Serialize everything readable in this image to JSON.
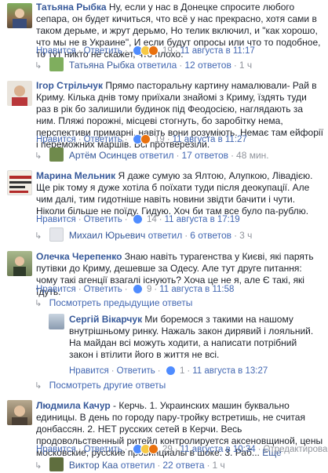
{
  "c1": {
    "author": "Татьяна Рыбка",
    "text": "Ну, если у нас в Донецке спросите любого сепара, он будет кичиться, что всё у нас прекрасно, хотя сами в таком дерьме, и жрут дерьмо, Но телик включил, и \"как хорошо, что мы не в Украине\", И если будут опросы или что то подобное, то тут никто не скажет, что плохо.",
    "like": "Нравится",
    "reply": "Ответить",
    "react_count": "19",
    "date": "11 августа в 11:17",
    "replies_by": "Татьяна Рыбка",
    "replied_word": "ответила",
    "replies_count": "12 ответов",
    "replies_time": "1 ч"
  },
  "c2": {
    "author": "Ігор Стрільчук",
    "text": "Прямо пасторальну картину намалювали- Рай в Криму. Кілька днів тому приїхали знайомі з Криму, їздять туди раз в рік бо залишили будинок під Феодосією, наглядають за ним. Пляжі порожні, місцеві стогнуть, бо заробітку нема, перспективи примарні, навіть вони розуміють. Немає там ейфорії і переможних маршів. Всі протверезіли.",
    "like": "Нравится",
    "reply": "Ответить",
    "react_count": "19",
    "date": "11 августа в 11:27",
    "replies_by": "Артём Осинцев",
    "replied_word": "ответил",
    "replies_count": "17 ответов",
    "replies_time": "48 мин."
  },
  "c3": {
    "author": "Марина Мельник",
    "text": "Я даже сумую за Ялтою, Алупкою, Лівадією. Ще рік тому я дуже хотіла б поїхати туди після деокупації. Але чим далі, тим гидотніше навіть новини звідти бачити і чути. Ніколи більше не поїду. Гидую. Хоч би там все було па-рублю.",
    "like": "Нравится",
    "reply": "Ответить",
    "react_count": "14",
    "date": "11 августа в 17:19",
    "replies_by": "Михаил Юрьевич",
    "replied_word": "ответил",
    "replies_count": "6 ответов",
    "replies_time": "3 ч"
  },
  "c4": {
    "author": "Олечка Черепенко",
    "text": "Знаю навіть турагенства у Києві, які парять путівки до Криму, дешевше за Одесу. Але тут друге питання: чому такі агенції взагалі існують? Хоча це не я, але Є такі, які їдуть.",
    "like": "Нравится",
    "reply": "Ответить",
    "react_count": "9",
    "date": "11 августа в 11:58",
    "prev_replies": "Посмотреть предыдущие ответы",
    "other_replies": "Посмотреть другие ответы"
  },
  "nested": {
    "author": "Сергій Вікарчук",
    "text": "Ми боремося з такими на нашому внутрішньому ринку. Нажаль закон дирявий і лояльний. На майдан всі можуть ходити, а написати потрібний закон і втілити його в життя не всі.",
    "like": "Нравится",
    "reply": "Ответить",
    "react_count": "1",
    "date": "11 августа в 13:27"
  },
  "c5": {
    "author": "Людмила Качур",
    "text": "- Керчь. 1. Украинских машин буквально единицы. В день по городу пару-тройку встретишь, не считая донбассян. 2. НЕТ русских сетей в Керчи. Весь продовольственный ритейл контролируется аксеновщиной, цены московские, русские провинциалы в шоке. 3. Раб...",
    "more": "Еще",
    "like": "Нравится",
    "reply": "Ответить",
    "react_count": "29",
    "date": "11 августа в 10:34",
    "edited": "Отредактирован",
    "replies_by": "Виктор Каа",
    "replied_word": "ответил",
    "replies_count": "22 ответа",
    "replies_time": "1 ч"
  },
  "icons": {
    "like": "like-icon",
    "haha": "haha-icon",
    "angry": "angry-icon",
    "reply_arrow": "reply-arrow-icon"
  }
}
